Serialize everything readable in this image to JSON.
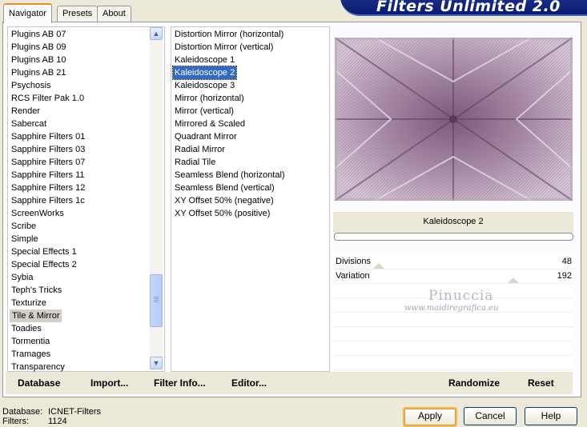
{
  "header": {
    "logo_text": "Filters Unlimited 2.0"
  },
  "tabs": [
    {
      "label": "Navigator",
      "active": true
    },
    {
      "label": "Presets",
      "active": false
    },
    {
      "label": "About",
      "active": false
    }
  ],
  "categories": [
    "Plugins AB 07",
    "Plugins AB 09",
    "Plugins AB 10",
    "Plugins AB 21",
    "Psychosis",
    "RCS Filter Pak 1.0",
    "Render",
    "Sabercat",
    "Sapphire Filters 01",
    "Sapphire Filters 03",
    "Sapphire Filters 07",
    "Sapphire Filters 11",
    "Sapphire Filters 12",
    "Sapphire Filters 1c",
    "ScreenWorks",
    "Scribe",
    "Simple",
    "Special Effects 1",
    "Special Effects 2",
    "Sybia",
    "Teph's Tricks",
    "Texturize",
    "Tile & Mirror",
    "Toadies",
    "Tormentia",
    "Tramages",
    "Transparency"
  ],
  "selected_category": "Tile & Mirror",
  "filters": [
    "Distortion Mirror (horizontal)",
    "Distortion Mirror (vertical)",
    "Kaleidoscope 1",
    "Kaleidoscope 2",
    "Kaleidoscope 3",
    "Mirror (horizontal)",
    "Mirror (vertical)",
    "Mirrored & Scaled",
    "Quadrant Mirror",
    "Radial Mirror",
    "Radial Tile",
    "Seamless Blend (horizontal)",
    "Seamless Blend (vertical)",
    "XY Offset 50% (negative)",
    "XY Offset 50% (positive)"
  ],
  "selected_filter": "Kaleidoscope 2",
  "preview": {
    "caption": "Kaleidoscope 2",
    "progress": 0
  },
  "params": [
    {
      "label": "Divisions",
      "value": "48",
      "slider": 0.19
    },
    {
      "label": "Variation",
      "value": "192",
      "slider": 0.75
    }
  ],
  "watermark": {
    "name": "Pinuccia",
    "url": "www.maidiregrafica.eu"
  },
  "toolbar": {
    "database": "Database",
    "import": "Import...",
    "filter_info": "Filter Info...",
    "editor": "Editor...",
    "randomize": "Randomize",
    "reset": "Reset"
  },
  "footer": {
    "database_label": "Database:",
    "database_value": "ICNET-Filters",
    "filters_label": "Filters:",
    "filters_value": "1124"
  },
  "buttons": {
    "apply": "Apply",
    "cancel": "Cancel",
    "help": "Help"
  },
  "colors": {
    "selection": "#316ac5",
    "logo_bg": "#0a1c6e",
    "tab_highlight": "#e68b2c",
    "preview_base": "#9a7d9c"
  },
  "icons": {
    "scroll_up": "chevron-up-icon",
    "scroll_down": "chevron-down-icon"
  }
}
